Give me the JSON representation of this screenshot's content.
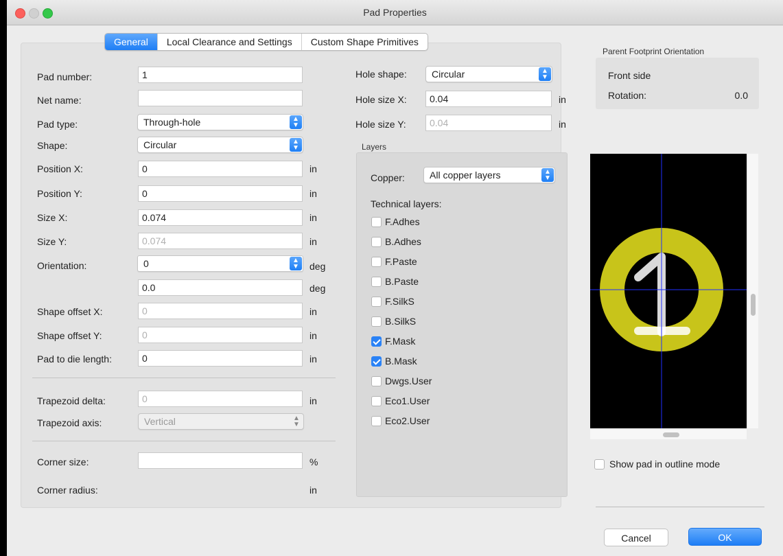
{
  "window": {
    "title": "Pad Properties"
  },
  "tabs": [
    "General",
    "Local Clearance and Settings",
    "Custom Shape Primitives"
  ],
  "left": {
    "pad_number": {
      "label": "Pad number:",
      "value": "1"
    },
    "net_name": {
      "label": "Net name:",
      "value": ""
    },
    "pad_type": {
      "label": "Pad type:",
      "value": "Through-hole"
    },
    "shape": {
      "label": "Shape:",
      "value": "Circular"
    },
    "position_x": {
      "label": "Position X:",
      "value": "0",
      "unit": "in"
    },
    "position_y": {
      "label": "Position Y:",
      "value": "0",
      "unit": "in"
    },
    "size_x": {
      "label": "Size X:",
      "value": "0.074",
      "unit": "in"
    },
    "size_y": {
      "label": "Size Y:",
      "value": "0.074",
      "unit": "in"
    },
    "orientation": {
      "label": "Orientation:",
      "value": "0",
      "unit": "deg",
      "value2": "0.0",
      "unit2": "deg"
    },
    "shape_offset_x": {
      "label": "Shape offset X:",
      "value": "0",
      "unit": "in"
    },
    "shape_offset_y": {
      "label": "Shape offset Y:",
      "value": "0",
      "unit": "in"
    },
    "pad_to_die": {
      "label": "Pad to die length:",
      "value": "0",
      "unit": "in"
    },
    "trapezoid_delta": {
      "label": "Trapezoid delta:",
      "value": "0",
      "unit": "in"
    },
    "trapezoid_axis": {
      "label": "Trapezoid axis:",
      "value": "Vertical"
    },
    "corner_size": {
      "label": "Corner size:",
      "value": "",
      "unit": "%"
    },
    "corner_radius": {
      "label": "Corner radius:",
      "unit": "in"
    }
  },
  "hole": {
    "shape": {
      "label": "Hole shape:",
      "value": "Circular"
    },
    "size_x": {
      "label": "Hole size X:",
      "value": "0.04",
      "unit": "in"
    },
    "size_y": {
      "label": "Hole size Y:",
      "value": "0.04",
      "unit": "in"
    }
  },
  "layers": {
    "title": "Layers",
    "copper_label": "Copper:",
    "copper_value": "All copper layers",
    "technical_label": "Technical layers:",
    "items": [
      {
        "label": "F.Adhes",
        "checked": false
      },
      {
        "label": "B.Adhes",
        "checked": false
      },
      {
        "label": "F.Paste",
        "checked": false
      },
      {
        "label": "B.Paste",
        "checked": false
      },
      {
        "label": "F.SilkS",
        "checked": false
      },
      {
        "label": "B.SilkS",
        "checked": false
      },
      {
        "label": "F.Mask",
        "checked": true
      },
      {
        "label": "B.Mask",
        "checked": true
      },
      {
        "label": "Dwgs.User",
        "checked": false
      },
      {
        "label": "Eco1.User",
        "checked": false
      },
      {
        "label": "Eco2.User",
        "checked": false
      }
    ]
  },
  "orientation_box": {
    "title": "Parent Footprint Orientation",
    "side": "Front side",
    "rotation_label": "Rotation:",
    "rotation_value": "0.0"
  },
  "preview": {
    "pad_color": "#c8c41a",
    "pad_label": "1",
    "crosshair_color": "#1f2fff"
  },
  "outline_mode": {
    "label": "Show pad in outline mode",
    "checked": false
  },
  "buttons": {
    "cancel": "Cancel",
    "ok": "OK"
  }
}
